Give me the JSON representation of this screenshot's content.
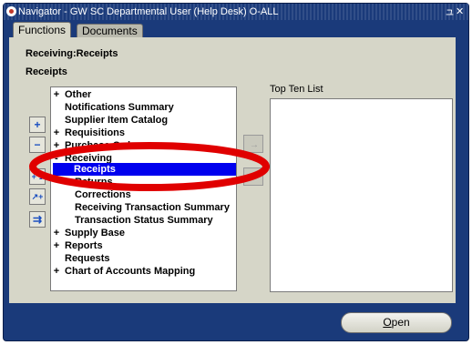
{
  "window": {
    "title": "Navigator - GW SC Departmental User (Help Desk) O-ALL",
    "controls": "ュ ✕"
  },
  "tabs": [
    {
      "label": "Functions",
      "active": true
    },
    {
      "label": "Documents",
      "active": false
    }
  ],
  "breadcrumb": "Receiving:Receipts",
  "section_title": "Receipts",
  "nav_items": [
    {
      "mark": "+",
      "label": "Other"
    },
    {
      "mark": "",
      "label": "Notifications Summary"
    },
    {
      "mark": "",
      "label": "Supplier Item Catalog"
    },
    {
      "mark": "+",
      "label": "Requisitions"
    },
    {
      "mark": "+",
      "label": "Purchase Orders"
    },
    {
      "mark": "-",
      "label": "Receiving"
    },
    {
      "mark": "",
      "label": "Receipts"
    },
    {
      "mark": "",
      "label": "Returns"
    },
    {
      "mark": "",
      "label": "Corrections"
    },
    {
      "mark": "",
      "label": "Receiving Transaction Summary"
    },
    {
      "mark": "",
      "label": "Transaction Status Summary"
    },
    {
      "mark": "+",
      "label": "Supply Base"
    },
    {
      "mark": "+",
      "label": "Reports"
    },
    {
      "mark": "",
      "label": "Requests"
    },
    {
      "mark": "+",
      "label": "Chart of Accounts Mapping"
    }
  ],
  "selected_item": "Receipts",
  "top_ten_label": "Top Ten List",
  "open_button": {
    "label": "Open",
    "mnemonic": "O"
  },
  "side_buttons": [
    {
      "icon": "expand-plus-icon",
      "glyph": "+"
    },
    {
      "icon": "collapse-minus-icon",
      "glyph": "−"
    },
    {
      "icon": "expand-branch-icon",
      "glyph": "⁺⁺"
    },
    {
      "icon": "expand-all-icon",
      "glyph": "⁺⁺"
    },
    {
      "icon": "collapse-all-icon",
      "glyph": "⇉"
    }
  ],
  "colors": {
    "window_frame": "#1a3a7a",
    "pane": "#d6d6c8",
    "selection": "#0000ee",
    "annotation_ring": "#e00000"
  }
}
